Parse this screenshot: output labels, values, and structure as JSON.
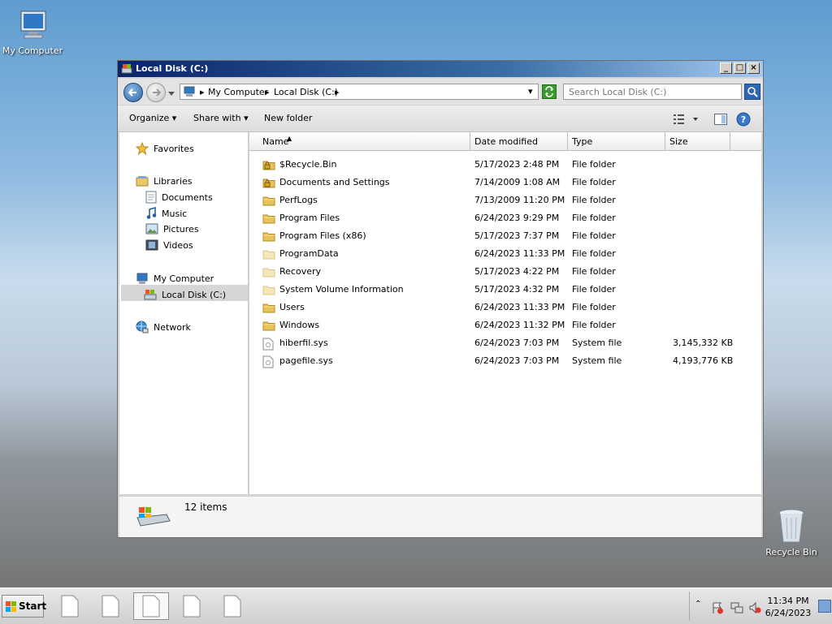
{
  "desktop": {
    "my_computer_label": "My Computer",
    "recycle_bin_label": "Recycle Bin"
  },
  "window": {
    "title": "Local Disk (C:)",
    "controls": {
      "minimize": "_",
      "maximize": "□",
      "close": "×"
    }
  },
  "address": {
    "crumbs": [
      "My Computer",
      "Local Disk (C:)"
    ],
    "search_placeholder": "Search Local Disk (C:)"
  },
  "toolbar": {
    "organize": "Organize",
    "share_with": "Share with",
    "new_folder": "New folder"
  },
  "nav": {
    "favorites": "Favorites",
    "libraries": "Libraries",
    "documents": "Documents",
    "music": "Music",
    "pictures": "Pictures",
    "videos": "Videos",
    "my_computer": "My Computer",
    "local_disk": "Local Disk (C:)",
    "network": "Network"
  },
  "columns": {
    "name": "Name",
    "date": "Date modified",
    "type": "Type",
    "size": "Size"
  },
  "files": [
    {
      "name": "$Recycle.Bin",
      "date": "5/17/2023 2:48 PM",
      "type": "File folder",
      "size": "",
      "icon": "locked-folder"
    },
    {
      "name": "Documents and Settings",
      "date": "7/14/2009 1:08 AM",
      "type": "File folder",
      "size": "",
      "icon": "locked-folder"
    },
    {
      "name": "PerfLogs",
      "date": "7/13/2009 11:20 PM",
      "type": "File folder",
      "size": "",
      "icon": "folder"
    },
    {
      "name": "Program Files",
      "date": "6/24/2023 9:29 PM",
      "type": "File folder",
      "size": "",
      "icon": "folder"
    },
    {
      "name": "Program Files (x86)",
      "date": "5/17/2023 7:37 PM",
      "type": "File folder",
      "size": "",
      "icon": "folder"
    },
    {
      "name": "ProgramData",
      "date": "6/24/2023 11:33 PM",
      "type": "File folder",
      "size": "",
      "icon": "hidden-folder"
    },
    {
      "name": "Recovery",
      "date": "5/17/2023 4:22 PM",
      "type": "File folder",
      "size": "",
      "icon": "hidden-folder"
    },
    {
      "name": "System Volume Information",
      "date": "5/17/2023 4:32 PM",
      "type": "File folder",
      "size": "",
      "icon": "hidden-folder"
    },
    {
      "name": "Users",
      "date": "6/24/2023 11:33 PM",
      "type": "File folder",
      "size": "",
      "icon": "folder"
    },
    {
      "name": "Windows",
      "date": "6/24/2023 11:32 PM",
      "type": "File folder",
      "size": "",
      "icon": "folder"
    },
    {
      "name": "hiberfil.sys",
      "date": "6/24/2023 7:03 PM",
      "type": "System file",
      "size": "3,145,332 KB",
      "icon": "system-file"
    },
    {
      "name": "pagefile.sys",
      "date": "6/24/2023 7:03 PM",
      "type": "System file",
      "size": "4,193,776 KB",
      "icon": "system-file"
    }
  ],
  "status": {
    "item_count": "12 items"
  },
  "taskbar": {
    "start_label": "Start",
    "clock_time": "11:34 PM",
    "clock_date": "6/24/2023"
  }
}
